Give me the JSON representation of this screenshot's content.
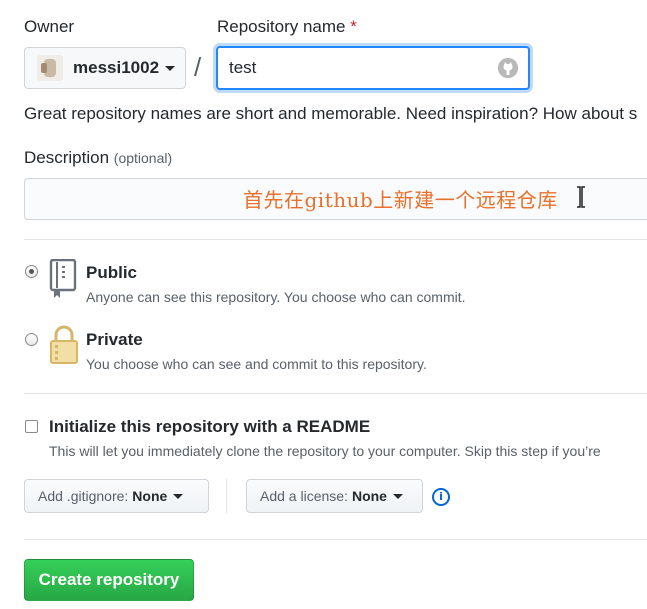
{
  "owner": {
    "label": "Owner",
    "name": "messi1002"
  },
  "repository": {
    "label": "Repository name",
    "required_mark": "*",
    "value": "test",
    "separator": "/"
  },
  "name_hint": "Great repository names are short and memorable. Need inspiration? How about s",
  "description": {
    "label": "Description",
    "optional": "(optional)",
    "value": "",
    "overlay_annotation": "首先在github上新建一个远程仓库"
  },
  "visibility": {
    "selected": "public",
    "options": [
      {
        "id": "public",
        "title": "Public",
        "description": "Anyone can see this repository. You choose who can commit."
      },
      {
        "id": "private",
        "title": "Private",
        "description": "You choose who can see and commit to this repository."
      }
    ]
  },
  "initialize": {
    "checked": false,
    "title": "Initialize this repository with a README",
    "description": "This will let you immediately clone the repository to your computer. Skip this step if you’re"
  },
  "gitignore": {
    "prefix": "Add .gitignore:",
    "value": "None"
  },
  "license": {
    "prefix": "Add a license:",
    "value": "None"
  },
  "create_button": "Create repository",
  "colors": {
    "focus_border": "#2188ff",
    "primary_green": "#28a745",
    "annotation_orange": "#e8702a",
    "info_blue": "#0366d6"
  },
  "icons": [
    "avatar",
    "chevron-down-icon",
    "github-mark-icon",
    "repo-icon",
    "lock-icon",
    "info-icon",
    "text-cursor-icon"
  ]
}
